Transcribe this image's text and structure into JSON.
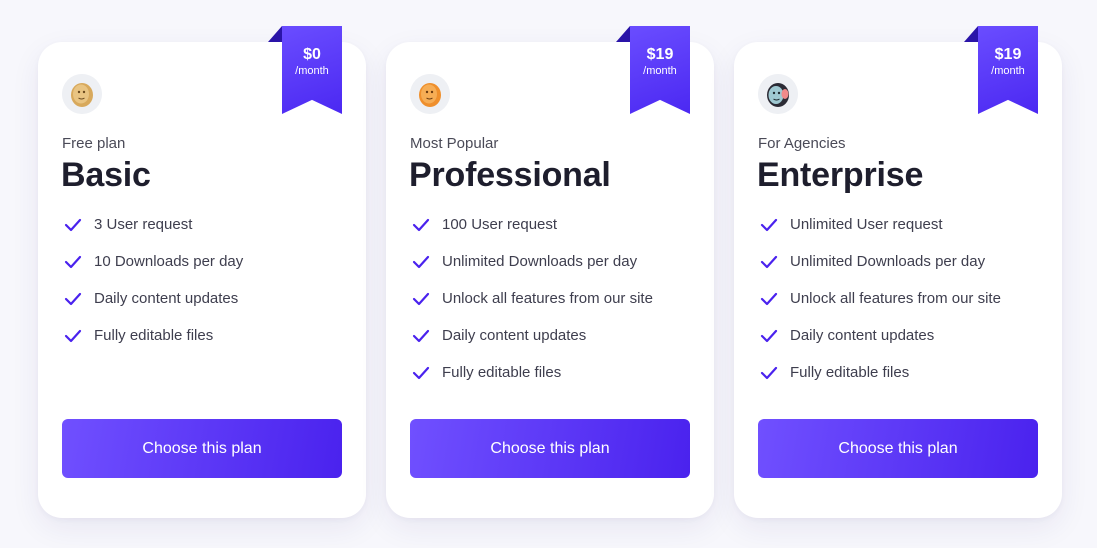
{
  "plans": [
    {
      "id": "basic",
      "price": "$0",
      "period": "/month",
      "eyebrow": "Free plan",
      "name": "Basic",
      "avatar_icon": "person-avatar-icon",
      "features": [
        "3 User request",
        "10 Downloads per day",
        "Daily content updates",
        "Fully editable files"
      ],
      "cta": "Choose this plan"
    },
    {
      "id": "professional",
      "price": "$19",
      "period": "/month",
      "eyebrow": "Most Popular",
      "name": "Professional",
      "avatar_icon": "person-avatar-icon",
      "features": [
        "100 User request",
        "Unlimited Downloads per day",
        "Unlock all features from our site",
        "Daily content updates",
        "Fully editable files"
      ],
      "cta": "Choose this plan"
    },
    {
      "id": "enterprise",
      "price": "$19",
      "period": "/month",
      "eyebrow": "For Agencies",
      "name": "Enterprise",
      "avatar_icon": "person-avatar-icon",
      "features": [
        "Unlimited User request",
        "Unlimited Downloads per day",
        "Unlock all features from our site",
        "Daily content updates",
        "Fully editable files"
      ],
      "cta": "Choose this plan"
    }
  ],
  "colors": {
    "accent": "#5b35f5",
    "accent_dark": "#4a22ee",
    "background": "#f7f7fc",
    "card": "#ffffff",
    "heading": "#1e1e2d",
    "text": "#3e3e4e"
  }
}
